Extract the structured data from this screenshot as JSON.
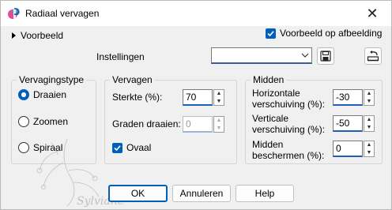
{
  "window": {
    "title": "Radiaal vervagen",
    "close_glyph": "✕"
  },
  "toolbar": {
    "preview_toggle_label": "Voorbeeld",
    "preview_on_image_label": "Voorbeeld op afbeelding",
    "preview_on_image_checked": true,
    "settings_label": "Instellingen",
    "settings_value": ""
  },
  "blur_type": {
    "title": "Vervagingstype",
    "options": [
      {
        "label": "Draaien",
        "selected": true
      },
      {
        "label": "Zoomen",
        "selected": false
      },
      {
        "label": "Spiraal",
        "selected": false
      }
    ]
  },
  "blur": {
    "title": "Vervagen",
    "strength_label": "Sterkte (%):",
    "strength_value": "70",
    "rotate_label": "Graden draaien:",
    "rotate_value": "0",
    "oval_label": "Ovaal",
    "oval_checked": true
  },
  "center": {
    "title": "Midden",
    "h_offset_label_1": "Horizontale",
    "h_offset_label_2": "verschuiving (%):",
    "h_offset_value": "-30",
    "v_offset_label_1": "Verticale",
    "v_offset_label_2": "verschuiving (%):",
    "v_offset_value": "-50",
    "protect_label_1": "Midden",
    "protect_label_2": "beschermen (%):",
    "protect_value": "0"
  },
  "buttons": {
    "ok": "OK",
    "cancel": "Annuleren",
    "help": "Help"
  },
  "watermark_text": "Sylviane",
  "colors": {
    "accent": "#005fb8",
    "background": "#f0f0f0"
  }
}
